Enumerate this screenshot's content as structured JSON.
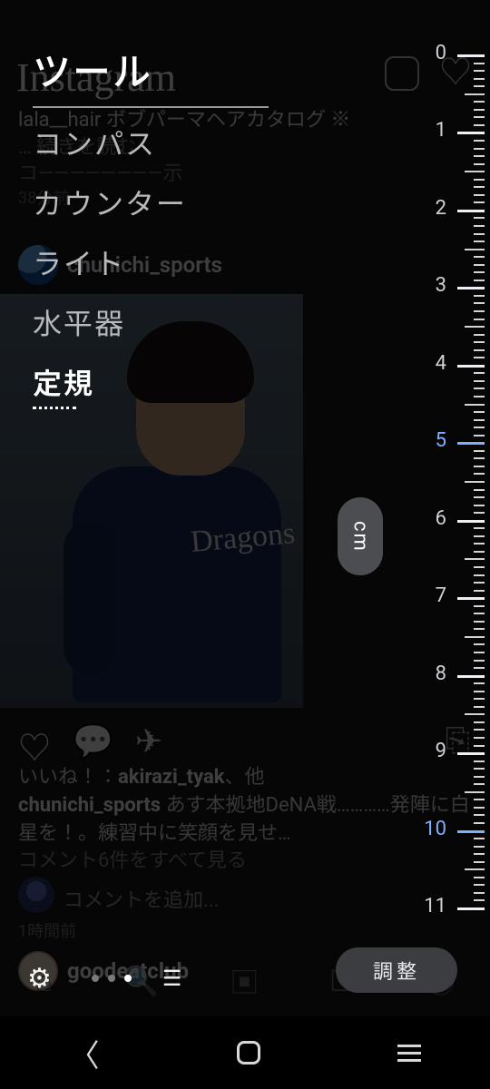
{
  "tools_panel": {
    "title": "ツール",
    "items": [
      {
        "label": "コンパス",
        "active": false
      },
      {
        "label": "カウンター",
        "active": false
      },
      {
        "label": "ライト",
        "active": false
      },
      {
        "label": "水平器",
        "active": false
      },
      {
        "label": "定規",
        "active": true
      }
    ],
    "unit_chip": "cm",
    "adjust_button": "調整",
    "page_indicator": {
      "count": 3,
      "active_index": 2
    }
  },
  "ruler": {
    "min": 0,
    "max": 11,
    "highlighted": [
      5,
      10
    ],
    "labels": [
      "0",
      "1",
      "2",
      "3",
      "4",
      "5",
      "6",
      "7",
      "8",
      "9",
      "10",
      "11"
    ]
  },
  "background_app": {
    "logo_text": "Instagram",
    "post1": {
      "tag_line": "lala__hair ボブパーマヘアカタログ ※",
      "more": "… 続きを読む",
      "cutoff": "コ――――――――示",
      "time": "38分前",
      "username": "chunichi_sports",
      "jersey_text": "Dragons"
    },
    "likes_line_prefix": "いいね！：",
    "likes_user": "akirazi_tyak",
    "likes_suffix": "、他",
    "caption_user": "chunichi_sports",
    "caption_text": " あす本拠地DeNA戦…………発陣に白星を！。練習中に笑顔を見せ…",
    "view_all": "コメント6件をすべて見る",
    "add_comment": "コメントを追加...",
    "time2": "1時間前",
    "user2": "goodeatclub"
  }
}
